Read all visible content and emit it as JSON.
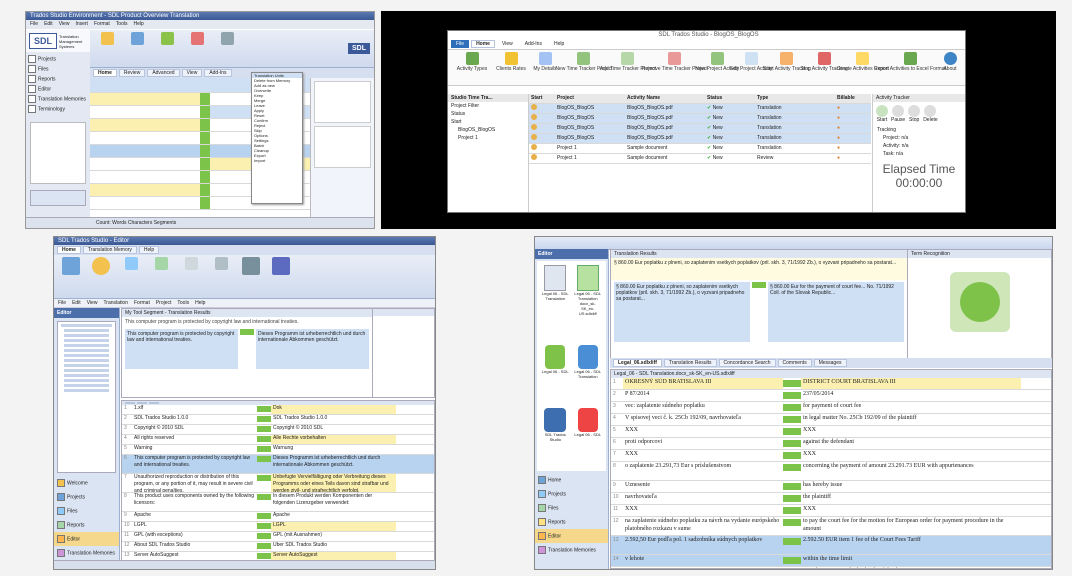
{
  "panel1": {
    "title": "Trados Studio Environment - SDL Product Overview Translation",
    "logo": "SDL",
    "logo_sub": "Translation Management Systems",
    "menu": [
      "File",
      "Edit",
      "View",
      "Insert",
      "Format",
      "Tools",
      "Help"
    ],
    "ribbon_tabs": [
      "Home",
      "Review",
      "Advanced",
      "View",
      "Add-Ins"
    ],
    "dropdown_items": [
      "Translation Units",
      "Delete from Memory",
      "Add as new",
      "Overwrite",
      "Keep",
      "Merge",
      "Leave",
      "Apply",
      "Reset",
      "Confirm",
      "Reject",
      "Skip",
      "Options",
      "Settings",
      "Batch",
      "Cleanup",
      "Export",
      "Import"
    ],
    "sidebar": [
      "Projects",
      "Files",
      "Reports",
      "Editor",
      "Translation Memories",
      "Terminology"
    ],
    "status": "Count: Words Characters Segments"
  },
  "panel2": {
    "title": "SDL Trados Studio - BlogOS_BlogOS",
    "ribbon_tabs": [
      "File",
      "Home",
      "View",
      "Add-Ins",
      "Help"
    ],
    "ribbon_buttons": [
      "Activity Types",
      "Clients Rates",
      "My Details",
      "New Time Tracker Project",
      "Add Time Tracker Project",
      "Remove Time Tracker Project",
      "New Project Activity",
      "Edit Project Activity",
      "Remove Project Activity",
      "Merge Project Activities",
      "Start Activity Tracking",
      "Stop Activity Tracking",
      "Create Activities Report",
      "Export Activities to Excel Format",
      "About"
    ],
    "tree_header": "Studio Time Tra...",
    "tree_items": [
      "Project Filter",
      "Status",
      "Start",
      "BlogOS_BlogOS",
      "Project 1"
    ],
    "grid_headers": [
      "Start",
      "Project",
      "Activity Name",
      "Status",
      "Type",
      "Billable"
    ],
    "rows": [
      {
        "project": "BlogOS_BlogOS",
        "activity": "BlogOS_BlogOS.pdf",
        "status": "New",
        "type": "Translation"
      },
      {
        "project": "BlogOS_BlogOS",
        "activity": "BlogOS_BlogOS.pdf",
        "status": "New",
        "type": "Translation"
      },
      {
        "project": "BlogOS_BlogOS",
        "activity": "BlogOS_BlogOS.pdf",
        "status": "New",
        "type": "Translation"
      },
      {
        "project": "BlogOS_BlogOS",
        "activity": "BlogOS_BlogOS.pdf",
        "status": "New",
        "type": "Translation"
      },
      {
        "project": "Project 1",
        "activity": "Sample document",
        "status": "New",
        "type": "Translation"
      },
      {
        "project": "Project 1",
        "activity": "Sample document",
        "status": "New",
        "type": "Review"
      }
    ],
    "timer_header": "Activity Tracker",
    "timer_buttons": [
      "Start",
      "Pause",
      "Stop",
      "Delete"
    ],
    "timer_fields": [
      "Tracking",
      "Project: n/a",
      "Activity: n/a",
      "Task: n/a"
    ],
    "elapsed_label": "Elapsed Time",
    "elapsed_value": "00:00:00"
  },
  "panel3": {
    "title": "SDL Trados Studio - Editor",
    "menu": [
      "File",
      "Edit",
      "View",
      "Translation",
      "Format",
      "Project",
      "Tools",
      "Help"
    ],
    "ribbon_tabs": [
      "Home",
      "Translation Memory",
      "Help"
    ],
    "nav_title": "Editor",
    "nav_items": [
      "Welcome",
      "Projects",
      "Files",
      "Reports",
      "Editor",
      "Translation Memories"
    ],
    "tm_header": "My Tool Segment - Translation Results",
    "tm_text": "This computer program is protected by copyright law and international treaties.",
    "tm_target": "Dieses Programm ist urheberrechtlich und durch internationale Abkommen geschützt.",
    "segments": [
      {
        "src": "1.xlf",
        "tgt": "Dok"
      },
      {
        "src": "SDL Trados Studio 1.0.0",
        "tgt": "SDL Trados Studio 1.0.0"
      },
      {
        "src": "Copyright © 2010 SDL",
        "tgt": "Copyright © 2010 SDL"
      },
      {
        "src": "All rights reserved",
        "tgt": "Alle Rechte vorbehalten"
      },
      {
        "src": "Warning",
        "tgt": "Warnung"
      },
      {
        "src": "This computer program is protected by copyright law and international treaties.",
        "tgt": "Dieses Programm ist urheberrechtlich und durch internationale Abkommen geschützt."
      },
      {
        "src": "Unauthorized reproduction or distribution of this program, or any portion of it, may result in severe civil and criminal penalties.",
        "tgt": "Unbefugte Vervielfältigung oder Verbreitung dieses Programms oder eines Teils davon sind strafbar und werden zivil- und strafrechtlich verfolgt."
      },
      {
        "src": "This product uses components owned by the following licensors:",
        "tgt": "In diesem Produkt werden Komponenten der folgenden Lizenzgeber verwendet:"
      },
      {
        "src": "Apache",
        "tgt": "Apache"
      },
      {
        "src": "LGPL",
        "tgt": "LGPL"
      },
      {
        "src": "GPL (with exceptions)",
        "tgt": "GPL (mit Ausnahmen)"
      },
      {
        "src": "About SDL Trados Studio",
        "tgt": "Über SDL Trados Studio"
      },
      {
        "src": "Server AutoSuggest",
        "tgt": "Server AutoSuggest"
      }
    ]
  },
  "panel4": {
    "title": "Legal_06 - SDL Trados Studio",
    "nav_title": "Editor",
    "files": [
      "Legal 06 - SDL Translation",
      "Legal 06 - SDL Translation docx_sk-SK_en-US.sdlxliff",
      "Legal 06 - SDL",
      "Legal 06 - SDL Translation",
      "SDL Trados Studio",
      "Legal 06 - SDL"
    ],
    "nav_items": [
      "Home",
      "Projects",
      "Files",
      "Reports",
      "Editor",
      "Translation Memories"
    ],
    "tm_tab": "Translation Results",
    "tm_src": "§ 860.00 Eur poplatku z plneni, so zaplatenim vsetkych poplatkov (pril. skh. 3, 71/1992 Zb.), o vyzvani pripadneho sa postarat...",
    "tm_tgt": "§ 860.00 Eur for the payment of court fee... No. 71/1992 Coll. of the Slovak Republic...",
    "panel_right": "Term Recognition",
    "tab_strip": [
      "Legal_06.sdlxliff",
      "Translation Results",
      "Concordance Search",
      "Comments",
      "Messages"
    ],
    "doc_tab": "Legal_06 - SDL Translation.docx_sk-SK_en-US.sdlxliff",
    "segments": [
      {
        "src": "OKRESNÝ SÚD BRATISLAVA III",
        "tgt": "DISTRICT COURT BRATISLAVA III"
      },
      {
        "src": "P 87/2014",
        "tgt": "237/05/2014"
      },
      {
        "src": "vec: zaplatenie súdneho poplatku",
        "tgt": "for payment of court fee"
      },
      {
        "src": "V spisovej veci č. k. 25Cb 192/09, navrhovateľa",
        "tgt": "in legal matter No. 25Cb 192/09 of the plaintiff"
      },
      {
        "src": "XXX",
        "tgt": "XXX"
      },
      {
        "src": "proti odporcovi",
        "tgt": "against the defendant"
      },
      {
        "src": "XXX",
        "tgt": "XXX"
      },
      {
        "src": "o zaplatenie 23.291,73 Eur s príslušenstvom",
        "tgt": "concerning the payment of amount 23.291.73 EUR with appurtenances"
      },
      {
        "src": "Uznesenie",
        "tgt": "has hereby issue"
      },
      {
        "src": "navrhovateľa",
        "tgt": "the plaintiff"
      },
      {
        "src": "XXX",
        "tgt": "XXX"
      },
      {
        "src": "na zaplatenie súdneho poplatku za návrh na vydanie európskeho platobného rozkazu v sume",
        "tgt": "to pay the court fee for the motion for European order for payment procedure in the amount"
      },
      {
        "src": "2.592,50 Eur podľa pol. 1 sadzobníka súdnych poplatkov",
        "tgt": "2.592.50 EUR item 1 fee of the Court Fees Tariff"
      },
      {
        "src": "v lehote",
        "tgt": "within the time limit"
      },
      {
        "src": "so súhlasom na úhradu nákladov, ak súdny poplatok nezaplatí",
        "tgt": "at its/he margin to the backside of the document"
      }
    ]
  }
}
